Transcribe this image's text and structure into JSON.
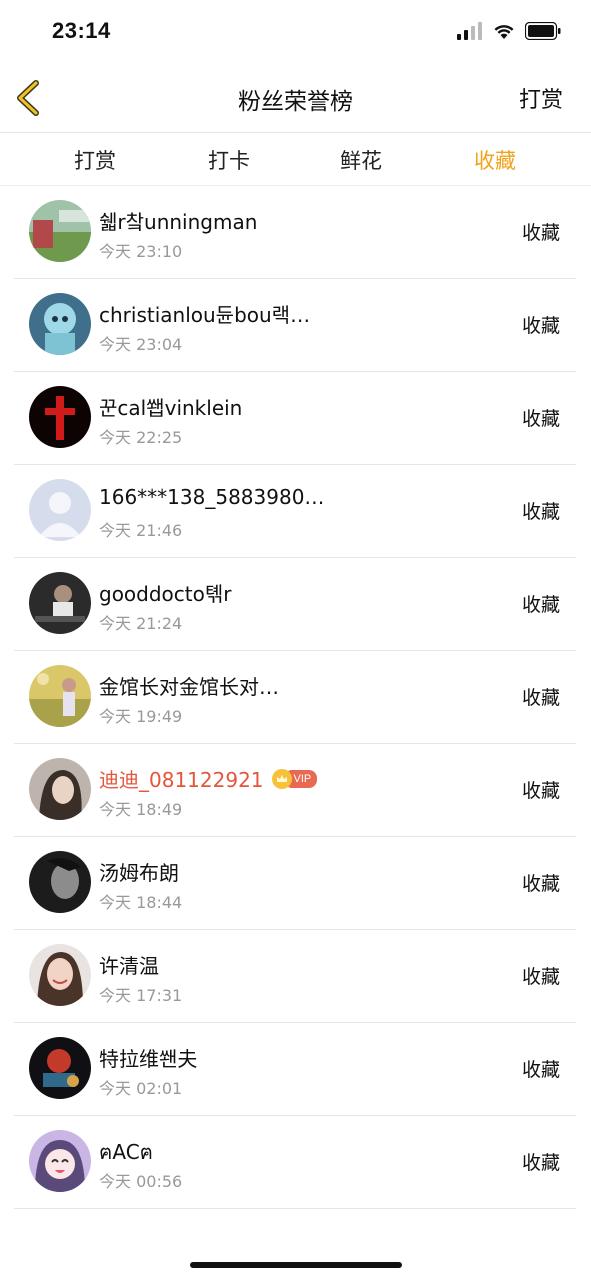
{
  "status": {
    "time": "23:14"
  },
  "nav": {
    "title": "粉丝荣誉榜",
    "right_label": "打赏"
  },
  "tabs": [
    {
      "label": "打赏",
      "active": false
    },
    {
      "label": "打卡",
      "active": false
    },
    {
      "label": "鲜花",
      "active": false
    },
    {
      "label": "收藏",
      "active": true
    }
  ],
  "colors": {
    "accent": "#f2a31b",
    "vip_name": "#e5553c",
    "secondary_text": "#999999"
  },
  "list": [
    {
      "name": "쉛r챀unningman",
      "time": "今天 23:10",
      "action": "收藏",
      "vip": false,
      "avatar": "avatar-landscape"
    },
    {
      "name": "christianlou듄bou랙…",
      "time": "今天 23:04",
      "action": "收藏",
      "vip": false,
      "avatar": "avatar-anime-blue"
    },
    {
      "name": "꾼cal쐡vinklein",
      "time": "今天 22:25",
      "action": "收藏",
      "vip": false,
      "avatar": "avatar-red-cross"
    },
    {
      "name": "166***138_5883980…",
      "time": "今天 21:46",
      "action": "收藏",
      "vip": false,
      "avatar": "avatar-default"
    },
    {
      "name": "gooddocto톆r",
      "time": "今天 21:24",
      "action": "收藏",
      "vip": false,
      "avatar": "avatar-dark-portrait"
    },
    {
      "name": "金馆长对金馆长对…",
      "time": "今天 19:49",
      "action": "收藏",
      "vip": false,
      "avatar": "avatar-field-girl"
    },
    {
      "name": "迪迪_081122921",
      "time": "今天 18:49",
      "action": "收藏",
      "vip": true,
      "vip_label": "VIP",
      "avatar": "avatar-girl-portrait"
    },
    {
      "name": "汤姆布朗",
      "time": "今天 18:44",
      "action": "收藏",
      "vip": false,
      "avatar": "avatar-bw-portrait"
    },
    {
      "name": "许清温",
      "time": "今天 17:31",
      "action": "收藏",
      "vip": false,
      "avatar": "avatar-smiling-girl"
    },
    {
      "name": "特拉维쐔夫",
      "time": "今天 02:01",
      "action": "收藏",
      "vip": false,
      "avatar": "avatar-dark-art"
    },
    {
      "name": "ฅACฅ",
      "time": "今天 00:56",
      "action": "收藏",
      "vip": false,
      "avatar": "avatar-anime-purple"
    }
  ]
}
